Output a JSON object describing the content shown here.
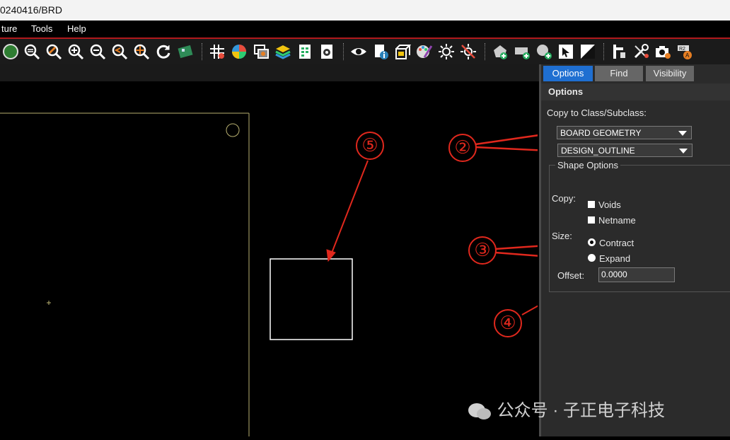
{
  "window": {
    "title_fragment": "0240416/BRD"
  },
  "menu": {
    "items": [
      "ture",
      "Tools",
      "Help"
    ]
  },
  "toolbar": {
    "icons": [
      "pcb-view-icon",
      "zoom-fit-icon",
      "zoom-selection-icon",
      "zoom-in-icon",
      "zoom-out-icon",
      "zoom-previous-icon",
      "zoom-center-icon",
      "redraw-icon",
      "board-icon",
      "grid-icon",
      "color-icon",
      "layer-visibility-icon",
      "stackup-icon",
      "report-icon",
      "settings-icon",
      "show-element-icon",
      "info-icon",
      "3d-view-icon",
      "paint-icon",
      "shadow-icon",
      "highlight-icon",
      "add-shape-icon",
      "add-rect-icon",
      "add-circle-icon",
      "select-shape-icon",
      "slash-shape-icon",
      "constraint-icon",
      "tools-icon",
      "snapshot-icon",
      "r2-icon"
    ]
  },
  "panel": {
    "tabs": [
      {
        "label": "Options",
        "active": true
      },
      {
        "label": "Find",
        "active": false
      },
      {
        "label": "Visibility",
        "active": false
      }
    ],
    "section_title": "Options",
    "copy_label": "Copy to Class/Subclass:",
    "class_value": "BOARD GEOMETRY",
    "subclass_value": "DESIGN_OUTLINE",
    "shape_options_label": "Shape Options",
    "copy_sublabel": "Copy:",
    "voids_label": "Voids",
    "netname_label": "Netname",
    "size_label": "Size:",
    "contract_label": "Contract",
    "expand_label": "Expand",
    "offset_label": "Offset:",
    "offset_value": "0.0000",
    "size_selected": "Contract"
  },
  "annotations": {
    "marker_2": "②",
    "marker_3": "③",
    "marker_4": "④",
    "marker_5": "⑤",
    "color": "#e0281d"
  },
  "watermark": {
    "text": "公众号 · 子正电子科技"
  }
}
